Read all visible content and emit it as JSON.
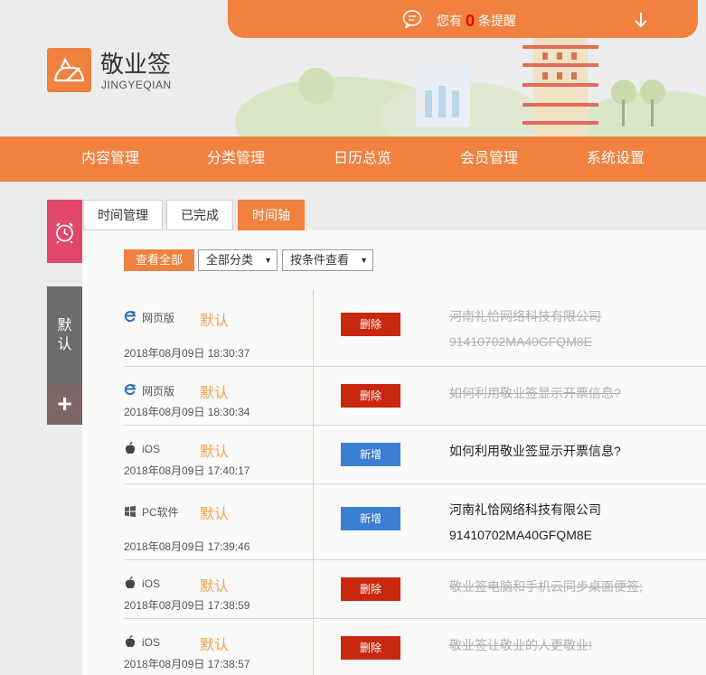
{
  "notice": {
    "prefix": "您有",
    "count": "0",
    "suffix": "条提醒"
  },
  "brand": {
    "name": "敬业签",
    "pinyin": "JINGYEQIAN"
  },
  "nav": [
    "内容管理",
    "分类管理",
    "日历总览",
    "会员管理",
    "系统设置"
  ],
  "sidebar": {
    "default_label_1": "默",
    "default_label_2": "认",
    "plus": "+"
  },
  "tabs": [
    "时间管理",
    "已完成",
    "时间轴"
  ],
  "filters": {
    "view_all": "查看全部",
    "category": "全部分类",
    "condition": "按条件查看"
  },
  "rows": [
    {
      "platform": "网页版",
      "platform_icon": "ie-icon",
      "category": "默认",
      "time": "2018年08月09日 18:30:37",
      "action": "删除",
      "line1": "河南礼恰网络科技有限公司",
      "line2": "91410702MA40GFQM8E"
    },
    {
      "platform": "网页版",
      "platform_icon": "ie-icon",
      "category": "默认",
      "time": "2018年08月09日 18:30:34",
      "action": "删除",
      "line1": "如何利用敬业签显示开票信息?"
    },
    {
      "platform": "iOS",
      "platform_icon": "apple-icon",
      "category": "默认",
      "time": "2018年08月09日 17:40:17",
      "action": "新增",
      "line1": "如何利用敬业签显示开票信息?"
    },
    {
      "platform": "PC软件",
      "platform_icon": "windows-icon",
      "category": "默认",
      "time": "2018年08月09日 17:39:46",
      "action": "新增",
      "line1": "河南礼恰网络科技有限公司",
      "line2": "91410702MA40GFQM8E"
    },
    {
      "platform": "iOS",
      "platform_icon": "apple-icon",
      "category": "默认",
      "time": "2018年08月09日 17:38:59",
      "action": "删除",
      "line1": "敬业签电脑和手机云同步桌面便签;"
    },
    {
      "platform": "iOS",
      "platform_icon": "apple-icon",
      "category": "默认",
      "time": "2018年08月09日 17:38:57",
      "action": "删除",
      "line1": "敬业签让敬业的人更敬业!"
    }
  ],
  "colors": {
    "accent": "#f0813f",
    "delete": "#c9280e",
    "add": "#3b7fd4",
    "alarm": "#e0476b"
  }
}
